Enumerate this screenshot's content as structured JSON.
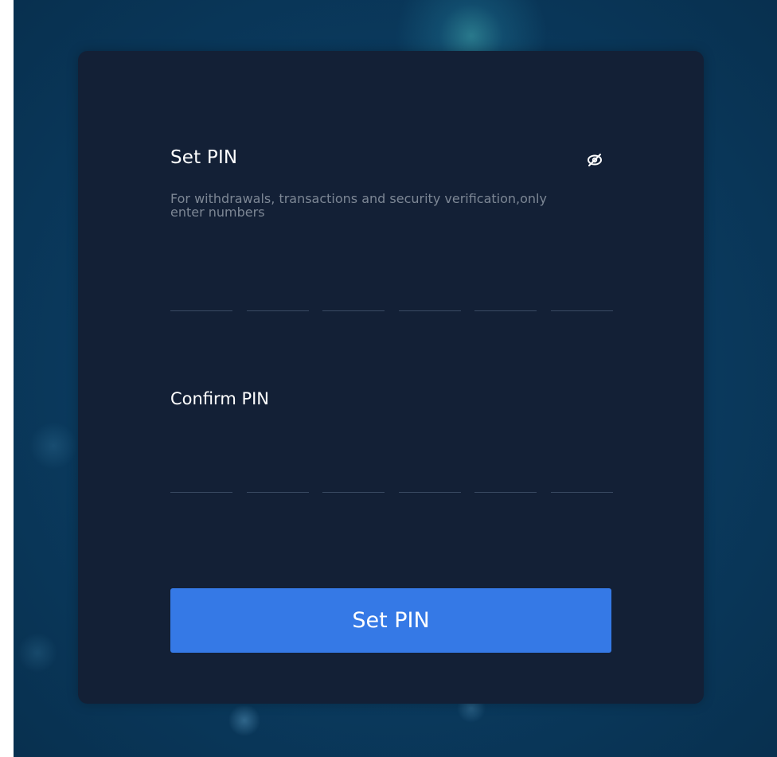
{
  "form": {
    "title": "Set PIN",
    "description": "For withdrawals, transactions and security verification,only enter numbers",
    "confirm_label": "Confirm PIN",
    "submit_label": "Set PIN",
    "visibility_icon": "eye-off-icon"
  },
  "pin": {
    "length": 6,
    "set_values": [
      "",
      "",
      "",
      "",
      "",
      ""
    ],
    "confirm_values": [
      "",
      "",
      "",
      "",
      "",
      ""
    ]
  },
  "colors": {
    "background": "#0a3a5e",
    "card": "#132036",
    "accent": "#3579e6",
    "subtitle_text": "#7d8795",
    "underline": "#3a4a63"
  }
}
